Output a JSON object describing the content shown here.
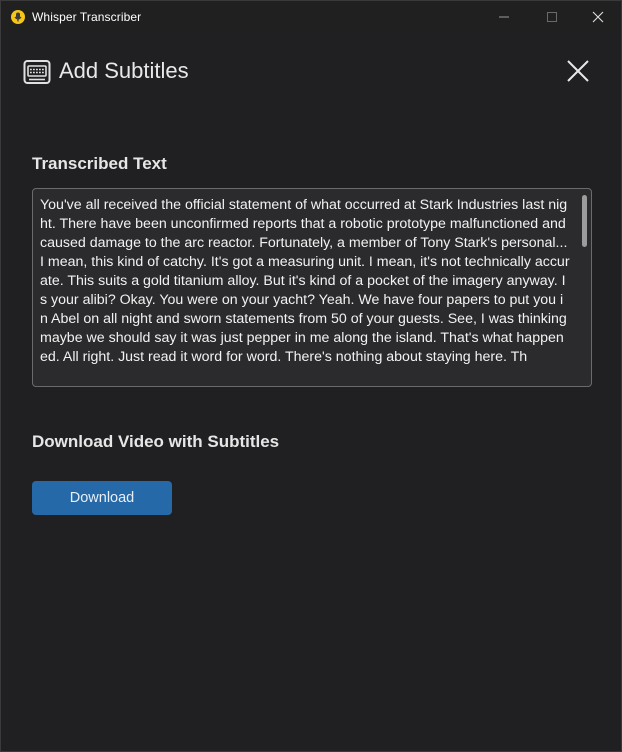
{
  "window": {
    "title": "Whisper Transcriber"
  },
  "header": {
    "title": "Add Subtitles",
    "icon": "subtitles-icon"
  },
  "transcribed": {
    "label": "Transcribed Text",
    "text": "You've all received the official statement of what occurred at Stark Industries last night. There have been unconfirmed reports that a robotic prototype malfunctioned and caused damage to the arc reactor. Fortunately, a member of Tony Stark's personal... I mean, this kind of catchy. It's got a measuring unit. I mean, it's not technically accurate. This suits a gold titanium alloy. But it's kind of a pocket of the imagery anyway. Is your alibi? Okay. You were on your yacht? Yeah. We have four papers to put you in Abel on all night and sworn statements from 50 of your guests. See, I was thinking maybe we should say it was just pepper in me along the island. That's what happened. All right. Just read it word for word. There's nothing about staying here. Th"
  },
  "download": {
    "label": "Download Video with Subtitles",
    "button": "Download"
  },
  "colors": {
    "background": "#202023",
    "accent": "#2569a8",
    "text": "#e6e6e6"
  }
}
